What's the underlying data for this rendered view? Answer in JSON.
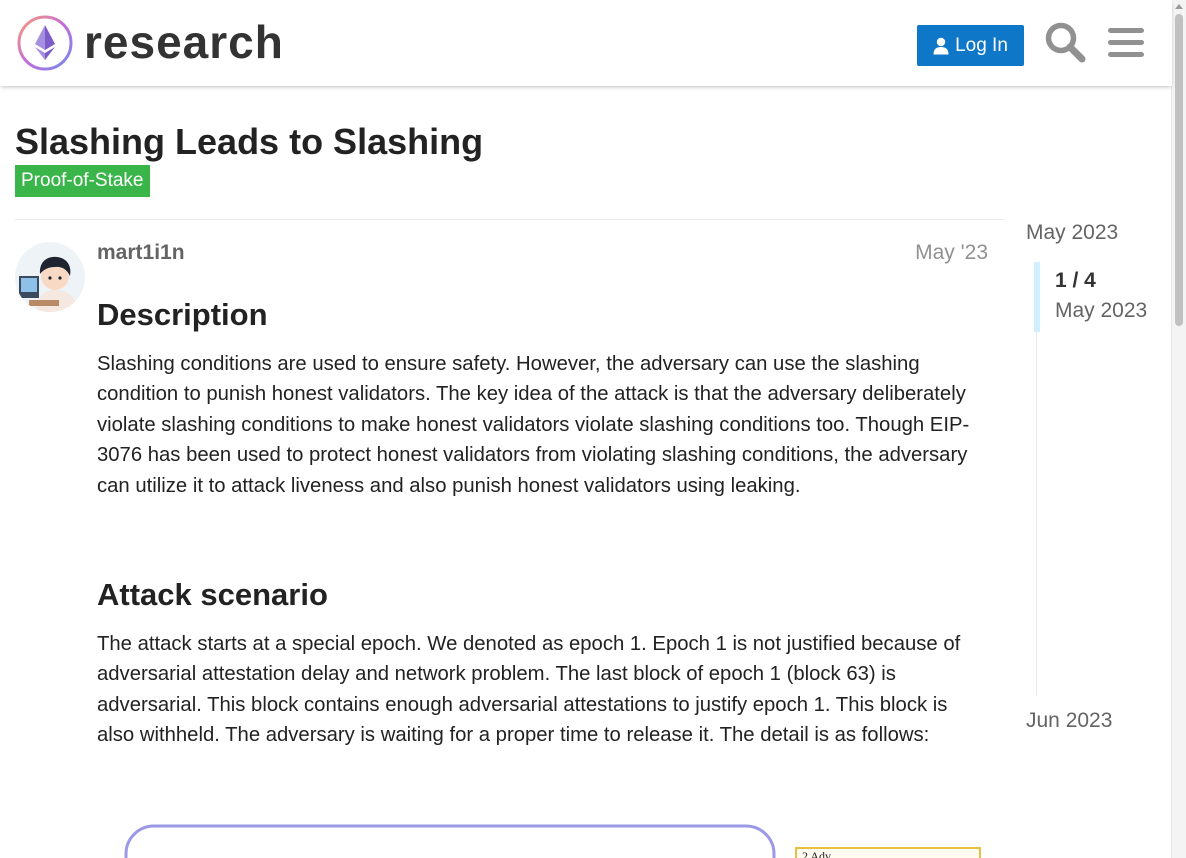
{
  "header": {
    "logo_text": "research",
    "login_label": "Log In",
    "search_icon": "search-icon",
    "menu_icon": "hamburger-menu-icon"
  },
  "topic": {
    "title": "Slashing Leads to Slashing",
    "category": "Proof-of-Stake",
    "category_color": "#3ab54a"
  },
  "post": {
    "username": "mart1i1n",
    "date": "May '23",
    "heading_description": "Description",
    "paragraph_description": "Slashing conditions are used to ensure safety. However, the adversary can use the slashing condition to punish honest validators. The key idea of the attack is that the adversary deliberately violate slashing conditions to make honest validators violate slashing conditions too. Though EIP-3076 has been used to protect honest validators from violating slashing conditions, the adversary can utilize it to attack liveness and also punish honest validators using leaking.",
    "heading_attack": "Attack scenario",
    "paragraph_attack": "The attack starts at a special epoch. We denoted as epoch 1. Epoch 1 is not justified because of adversarial attestation delay and network problem. The last block of epoch 1 (block 63) is adversarial. This block contains enough adversarial attestations to justify epoch 1. This block is also withheld. The adversary is waiting for a proper time to release it. The detail is as follows:",
    "diagram_caption_fragment": "2 Adv."
  },
  "timeline": {
    "start_label": "May 2023",
    "position": "1 / 4",
    "current_date": "May 2023",
    "end_label": "Jun 2023"
  },
  "colors": {
    "primary": "#0e77c7",
    "text": "#222222",
    "muted": "#646464"
  }
}
